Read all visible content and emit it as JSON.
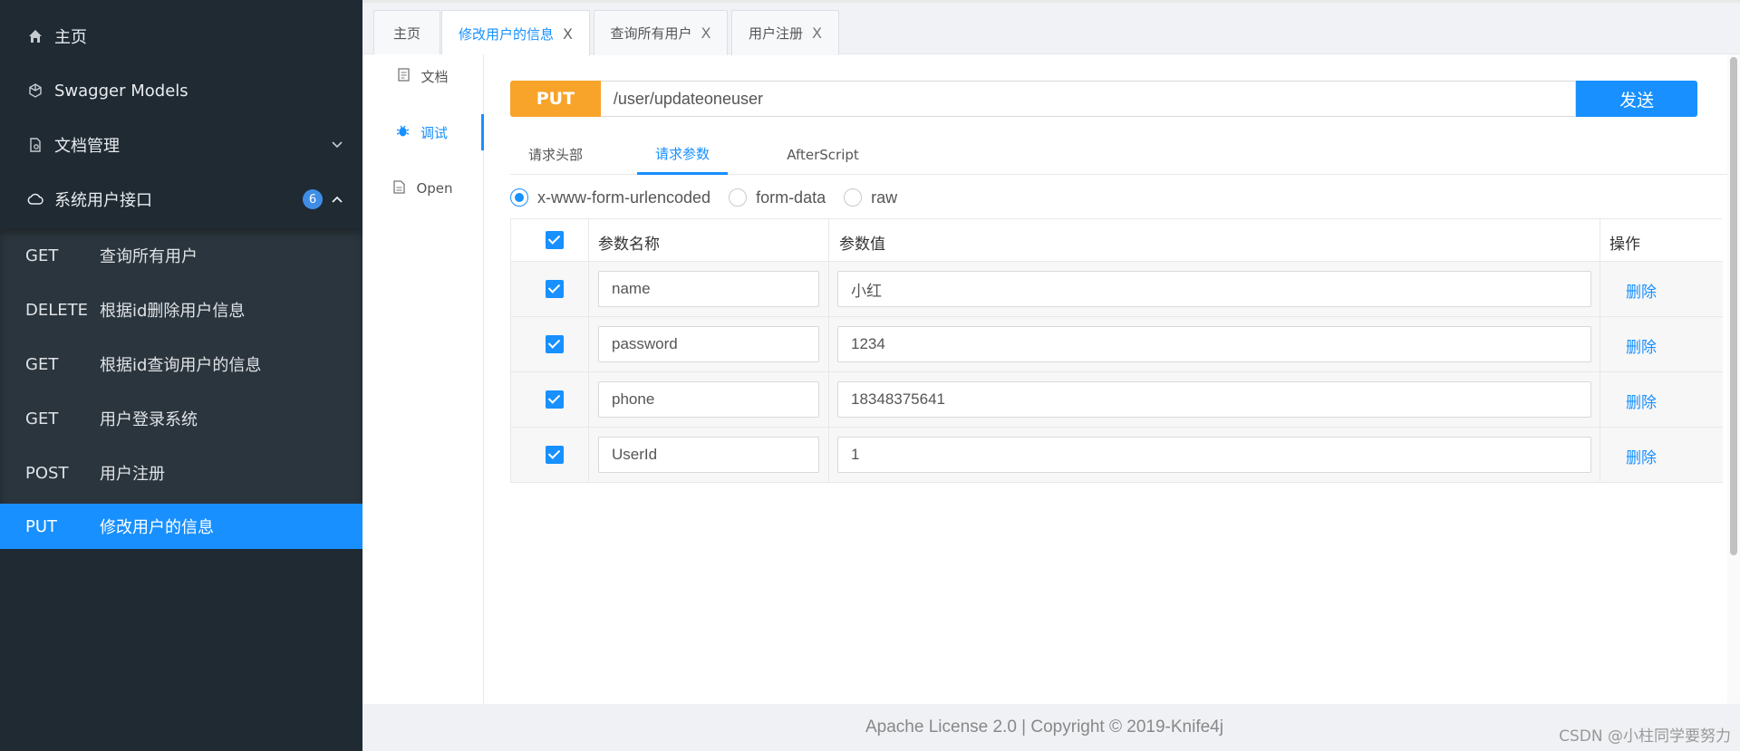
{
  "sidebar": {
    "items": [
      {
        "label": "主页",
        "icon": "home-icon"
      },
      {
        "label": "Swagger Models",
        "icon": "cube-icon"
      },
      {
        "label": "文档管理",
        "icon": "file-settings-icon"
      },
      {
        "label": "系统用户接口",
        "icon": "cloud-icon",
        "badge": "6"
      }
    ],
    "apis": [
      {
        "method": "GET",
        "name": "查询所有用户"
      },
      {
        "method": "DELETE",
        "name": "根据id删除用户信息"
      },
      {
        "method": "GET",
        "name": "根据id查询用户的信息"
      },
      {
        "method": "GET",
        "name": "用户登录系统"
      },
      {
        "method": "POST",
        "name": "用户注册"
      },
      {
        "method": "PUT",
        "name": "修改用户的信息"
      }
    ]
  },
  "tabs": [
    {
      "label": "主页"
    },
    {
      "label": "修改用户的信息",
      "close": "X"
    },
    {
      "label": "查询所有用户",
      "close": "X"
    },
    {
      "label": "用户注册",
      "close": "X"
    }
  ],
  "subnav": [
    {
      "label": "文档",
      "icon": "document-icon"
    },
    {
      "label": "调试",
      "icon": "bug-icon"
    },
    {
      "label": "Open",
      "icon": "file-icon"
    }
  ],
  "request": {
    "method": "PUT",
    "url": "/user/updateoneuser",
    "send_label": "发送",
    "tabs": [
      "请求头部",
      "请求参数",
      "AfterScript"
    ],
    "content_types": [
      "x-www-form-urlencoded",
      "form-data",
      "raw"
    ],
    "selected_content_type": "x-www-form-urlencoded"
  },
  "params": {
    "headers": {
      "name": "参数名称",
      "value": "参数值",
      "action": "操作"
    },
    "rows": [
      {
        "name": "name",
        "value": "小红",
        "action": "删除"
      },
      {
        "name": "password",
        "value": "1234",
        "action": "删除"
      },
      {
        "name": "phone",
        "value": "18348375641",
        "action": "删除"
      },
      {
        "name": "UserId",
        "value": "1",
        "action": "删除"
      }
    ]
  },
  "footer": {
    "license": "Apache License 2.0 | Copyright © 2019-Knife4j",
    "watermark": "CSDN @小柱同学要努力"
  },
  "colors": {
    "sidebar_bg": "#1f2a33",
    "accent": "#1890ff",
    "put_method": "#f8a32a"
  }
}
